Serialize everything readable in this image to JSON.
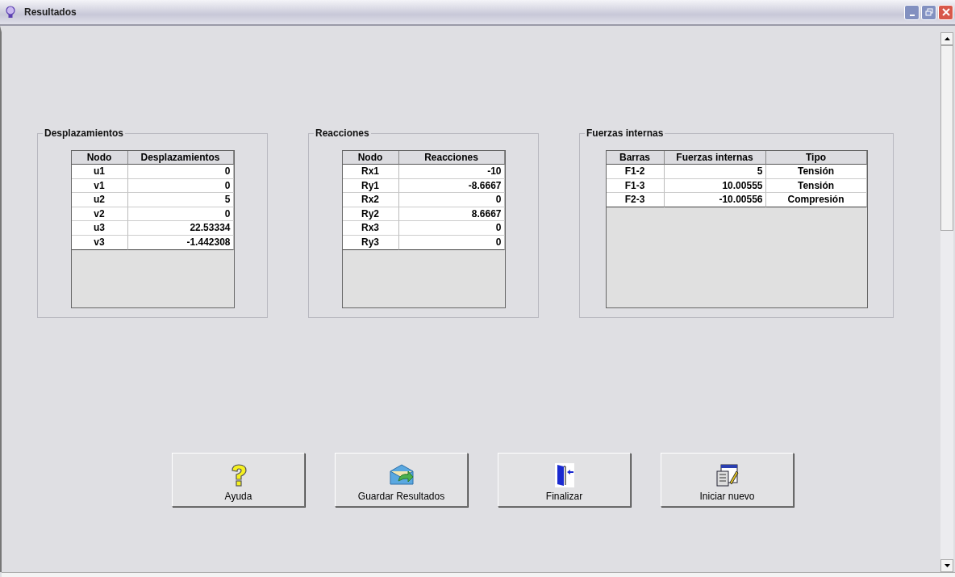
{
  "window": {
    "title": "Resultados"
  },
  "groups": [
    {
      "title": "Desplazamientos",
      "columns": [
        {
          "label": "Nodo",
          "kind": "label"
        },
        {
          "label": "Desplazamientos",
          "kind": "number"
        }
      ],
      "rows": [
        [
          "u1",
          "0"
        ],
        [
          "v1",
          "0"
        ],
        [
          "u2",
          "5"
        ],
        [
          "v2",
          "0"
        ],
        [
          "u3",
          "22.53334"
        ],
        [
          "v3",
          "-1.442308"
        ]
      ]
    },
    {
      "title": "Reacciones",
      "columns": [
        {
          "label": "Nodo",
          "kind": "label"
        },
        {
          "label": "Reacciones",
          "kind": "number"
        }
      ],
      "rows": [
        [
          "Rx1",
          "-10"
        ],
        [
          "Ry1",
          "-8.6667"
        ],
        [
          "Rx2",
          "0"
        ],
        [
          "Ry2",
          "8.6667"
        ],
        [
          "Rx3",
          "0"
        ],
        [
          "Ry3",
          "0"
        ]
      ]
    },
    {
      "title": "Fuerzas internas",
      "columns": [
        {
          "label": "Barras",
          "kind": "label"
        },
        {
          "label": "Fuerzas internas",
          "kind": "number"
        },
        {
          "label": "Tipo",
          "kind": "label"
        }
      ],
      "rows": [
        [
          "F1-2",
          "5",
          "Tensión"
        ],
        [
          "F1-3",
          "10.00555",
          "Tensión"
        ],
        [
          "F2-3",
          "-10.00556",
          "Compresión"
        ]
      ]
    }
  ],
  "buttons": [
    {
      "label": "Ayuda",
      "kind": "help"
    },
    {
      "label": "Guardar Resultados",
      "kind": "save"
    },
    {
      "label": "Finalizar",
      "kind": "exit"
    },
    {
      "label": "Iniciar nuevo",
      "kind": "new"
    }
  ]
}
